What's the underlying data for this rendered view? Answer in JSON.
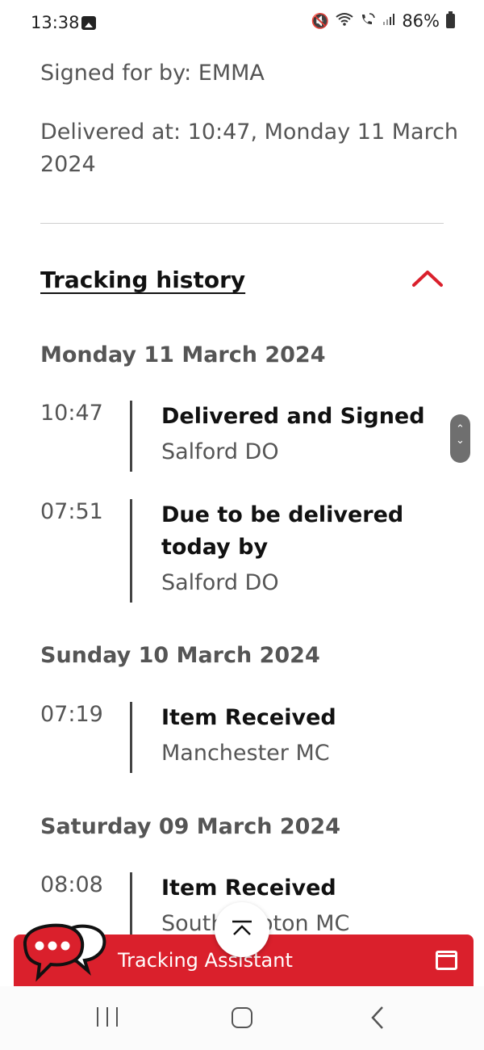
{
  "status_bar": {
    "time": "13:38",
    "battery_percent": "86%"
  },
  "delivery": {
    "signed_for": "Signed for by: EMMA",
    "delivered_at_line1": "Delivered at: 10:47, Monday 11 March",
    "delivered_at_line2": "2024"
  },
  "tracking": {
    "title": "Tracking history",
    "days": [
      {
        "date": "Monday 11 March 2024",
        "events": [
          {
            "time": "10:47",
            "title": "Delivered and Signed",
            "location": "Salford DO"
          },
          {
            "time": "07:51",
            "title": "Due to be delivered today by",
            "location": "Salford DO"
          }
        ]
      },
      {
        "date": "Sunday 10 March 2024",
        "events": [
          {
            "time": "07:19",
            "title": "Item Received",
            "location": "Manchester MC"
          }
        ]
      },
      {
        "date": "Saturday 09 March 2024",
        "events": [
          {
            "time": "08:08",
            "title": "Item Received",
            "location": "Southampton MC"
          }
        ]
      }
    ]
  },
  "assistant": {
    "label": "Tracking Assistant"
  },
  "colors": {
    "brand_red": "#da202c",
    "text_dark": "#111111",
    "text_muted": "#555555"
  },
  "icons": {
    "status": [
      "gallery-icon",
      "mute-icon",
      "wifi-icon",
      "wifi-calling-icon",
      "signal-icon",
      "battery-icon"
    ],
    "nav": [
      "recent-apps-icon",
      "home-icon",
      "back-icon"
    ]
  }
}
